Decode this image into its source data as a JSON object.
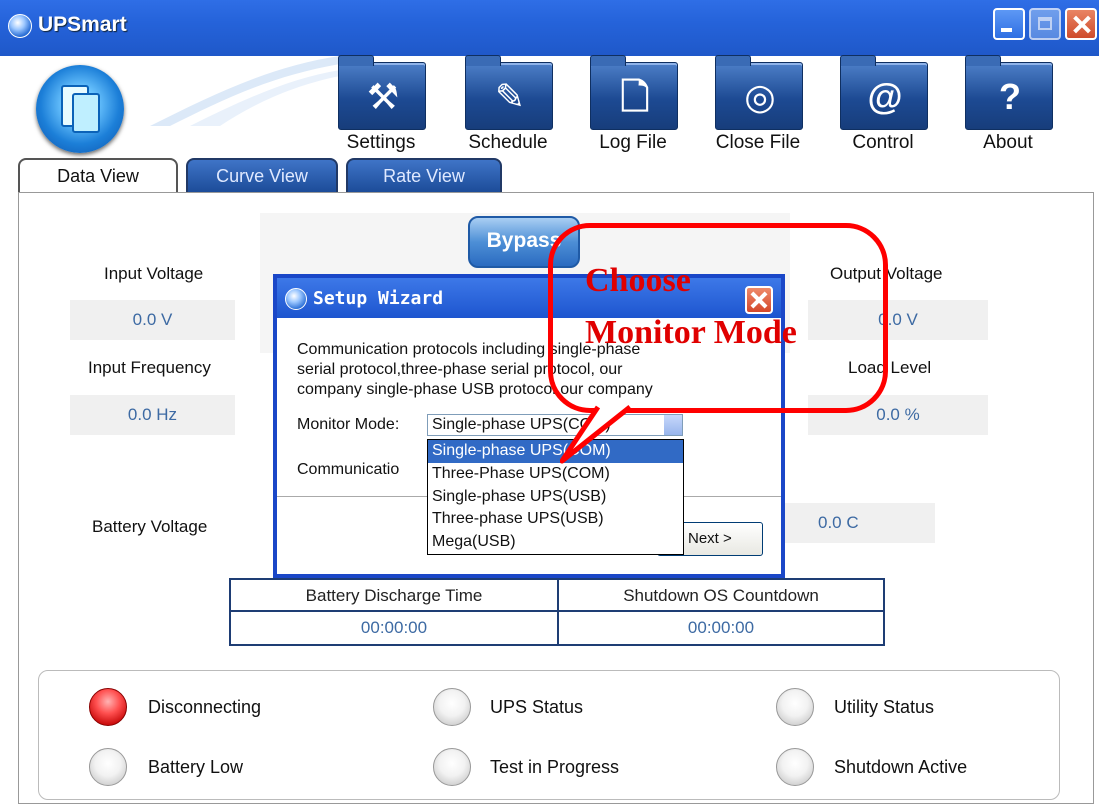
{
  "app": {
    "title": "UPSmart"
  },
  "toolbar": [
    {
      "label": "Settings",
      "icon": "hammer-icon",
      "glyph": "⚒"
    },
    {
      "label": "Schedule",
      "icon": "pen-icon",
      "glyph": "✎"
    },
    {
      "label": "Log File",
      "icon": "document-icon",
      "glyph": "🗋"
    },
    {
      "label": "Close File",
      "icon": "disc-icon",
      "glyph": "◎"
    },
    {
      "label": "Control",
      "icon": "at-icon",
      "glyph": "@"
    },
    {
      "label": "About",
      "icon": "question-icon",
      "glyph": "?"
    }
  ],
  "tabs": [
    {
      "label": "Data View"
    },
    {
      "label": "Curve View"
    },
    {
      "label": "Rate View"
    }
  ],
  "readings": {
    "input_voltage": {
      "label": "Input Voltage",
      "value": "0.0 V"
    },
    "input_frequency": {
      "label": "Input Frequency",
      "value": "0.0 Hz"
    },
    "battery_voltage": {
      "label": "Battery Voltage"
    },
    "output_voltage": {
      "label": "Output Voltage",
      "value": "0.0 V"
    },
    "load_level": {
      "label": "Load Level",
      "value": "0.0 %"
    },
    "temperature": {
      "value": "0.0 C"
    }
  },
  "diagram": {
    "bypass_label": "Bypass"
  },
  "times": {
    "discharge_header": "Battery Discharge Time",
    "discharge_value": "00:00:00",
    "shutdown_header": "Shutdown OS Countdown",
    "shutdown_value": "00:00:00"
  },
  "status": [
    {
      "label": "Disconnecting",
      "state": "red"
    },
    {
      "label": "UPS Status",
      "state": "off"
    },
    {
      "label": "Utility Status",
      "state": "off"
    },
    {
      "label": "Battery Low",
      "state": "off"
    },
    {
      "label": "Test in Progress",
      "state": "off"
    },
    {
      "label": "Shutdown Active",
      "state": "off"
    }
  ],
  "dialog": {
    "title": "Setup Wizard",
    "description_lines": [
      "Communication protocols including single-phase",
      "serial protocol,three-phase serial protocol, our",
      "company single-phase USB protocol,our company"
    ],
    "monitor_mode_label": "Monitor Mode:",
    "monitor_mode_value": "Single-phase UPS(COM)",
    "communication_label": "Communicatio",
    "next_label": "Next >",
    "options": [
      {
        "label": "Single-phase UPS(COM)",
        "selected": true
      },
      {
        "label": "Three-Phase UPS(COM)",
        "selected": false
      },
      {
        "label": "Single-phase UPS(USB)",
        "selected": false
      },
      {
        "label": "Three-phase UPS(USB)",
        "selected": false
      },
      {
        "label": "Mega(USB)",
        "selected": false
      }
    ]
  },
  "annotation": {
    "line1": "Choose",
    "line2": "Monitor Mode",
    "color": "#e00000"
  }
}
